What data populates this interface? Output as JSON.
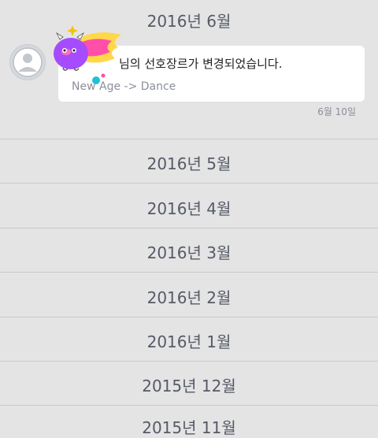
{
  "months": [
    "2016년 6월",
    "2016년 5월",
    "2016년 4월",
    "2016년 3월",
    "2016년 2월",
    "2016년 1월",
    "2015년 12월",
    "2015년 11월"
  ],
  "notification": {
    "title": "님의 선호장르가 변경되었습니다.",
    "subtitle": "New Age -> Dance",
    "date": "6월 10일",
    "sticker_icon": "purple-blob-sticker-icon",
    "avatar_icon": "default-user-avatar-icon"
  },
  "colors": {
    "background": "#e4e4e4",
    "header_text": "#555a66",
    "bubble": "#ffffff",
    "divider": "#c9c9c9"
  }
}
